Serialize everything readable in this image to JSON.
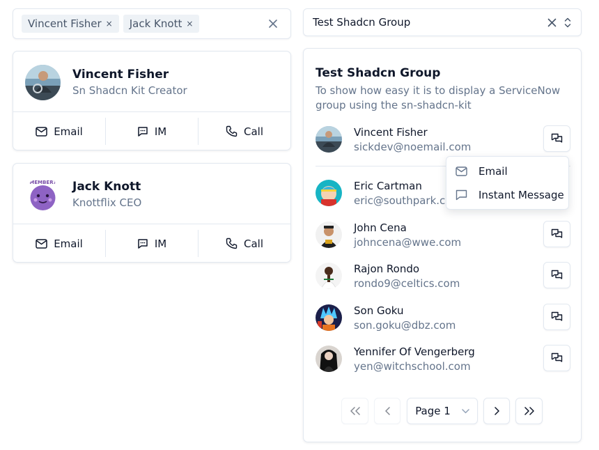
{
  "left": {
    "multi_select": {
      "chips": [
        {
          "label": "Vincent Fisher",
          "remove": "×"
        },
        {
          "label": "Jack Knott",
          "remove": "×"
        }
      ]
    },
    "cards": [
      {
        "name": "Vincent Fisher",
        "role": "Sn Shadcn Kit Creator",
        "actions": {
          "email": "Email",
          "im": "IM",
          "call": "Call"
        }
      },
      {
        "name": "Jack Knott",
        "role": "Knottflix CEO",
        "actions": {
          "email": "Email",
          "im": "IM",
          "call": "Call"
        }
      }
    ]
  },
  "right": {
    "group_select": {
      "value": "Test Shadcn Group"
    },
    "group": {
      "title": "Test Shadcn Group",
      "description": "To show how easy it is to display a ServiceNow group using the sn-shadcn-kit",
      "members": [
        {
          "name": "Vincent Fisher",
          "email": "sickdev@noemail.com"
        },
        {
          "name": "Eric Cartman",
          "email": "eric@southpark.com"
        },
        {
          "name": "John Cena",
          "email": "johncena@wwe.com"
        },
        {
          "name": "Rajon Rondo",
          "email": "rondo9@celtics.com"
        },
        {
          "name": "Son Goku",
          "email": "son.goku@dbz.com"
        },
        {
          "name": "Yennifer Of Vengerberg",
          "email": "yen@witchschool.com"
        }
      ]
    },
    "contact_menu": {
      "items": [
        {
          "label": "Email",
          "icon": "mail-icon"
        },
        {
          "label": "Instant Message",
          "icon": "message-square-icon"
        }
      ]
    },
    "pagination": {
      "first": "«",
      "prev": "‹",
      "page_label": "Page 1",
      "next": "›",
      "last": "»"
    }
  },
  "colors": {
    "border": "#e2e8f0",
    "text": "#0f172a",
    "muted": "#64748b",
    "chip_bg": "#eef2f6"
  }
}
